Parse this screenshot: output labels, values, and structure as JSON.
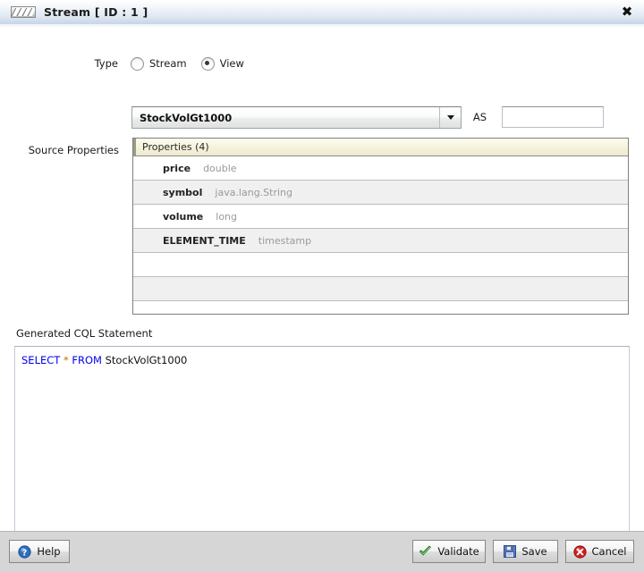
{
  "window": {
    "title": "Stream [ ID : 1 ]",
    "icon": "stream-icon",
    "close_label": "✖"
  },
  "form": {
    "type": {
      "label": "Type",
      "options": [
        {
          "label": "Stream",
          "selected": false
        },
        {
          "label": "View",
          "selected": true
        }
      ]
    },
    "source_select": {
      "value": "StockVolGt1000",
      "arrow_icon": "chevron-down-icon"
    },
    "as_field": {
      "label": "AS",
      "value": "",
      "placeholder": ""
    },
    "source_properties": {
      "label": "Source Properties",
      "table_header": "Properties (4)",
      "rows": [
        {
          "name": "price",
          "type": "double"
        },
        {
          "name": "symbol",
          "type": "java.lang.String"
        },
        {
          "name": "volume",
          "type": "long"
        },
        {
          "name": "ELEMENT_TIME",
          "type": "timestamp"
        },
        {
          "name": "",
          "type": ""
        },
        {
          "name": "",
          "type": ""
        }
      ]
    },
    "cql": {
      "label": "Generated CQL Statement",
      "tokens": {
        "select": "SELECT",
        "star": "*",
        "from": "FROM",
        "source": "StockVolGt1000"
      },
      "full_text": "SELECT * FROM StockVolGt1000"
    }
  },
  "footer": {
    "help": {
      "label": "Help",
      "icon": "help-question-icon"
    },
    "validate": {
      "label": "Validate",
      "icon": "check-mark-icon"
    },
    "save": {
      "label": "Save",
      "icon": "floppy-disk-icon"
    },
    "cancel": {
      "label": "Cancel",
      "icon": "cancel-circle-icon"
    }
  },
  "colors": {
    "titlebar_accent": "#c6d4e8",
    "table_header": "#f6f4de",
    "keyword": "#0000ee",
    "star": "#cc6600",
    "footer_bg": "#d6d6d6"
  }
}
